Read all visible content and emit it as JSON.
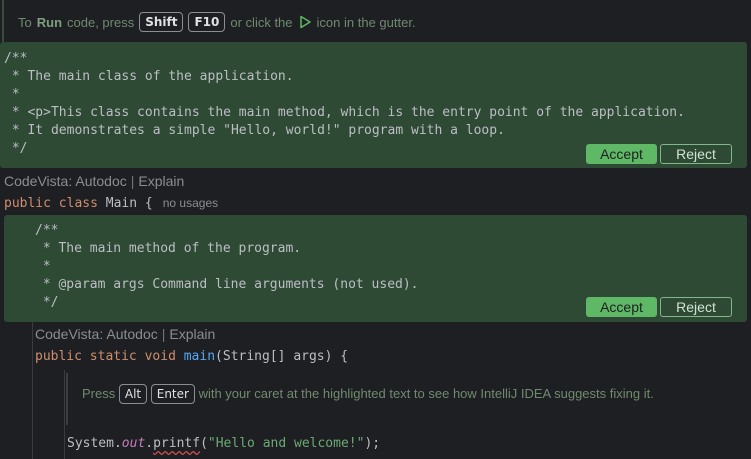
{
  "tip": {
    "prefix": "To",
    "run_word": "Run",
    "middle": "code, press",
    "key1": "Shift",
    "key2": "F10",
    "suffix1": "or click the",
    "suffix2": "icon in the gutter."
  },
  "doc1": {
    "lines": [
      "/**",
      " * The main class of the application.",
      " *",
      " * <p>This class contains the main method, which is the entry point of the application.",
      " * It demonstrates a simple \"Hello, world!\" program with a loop.",
      " */"
    ],
    "accept_label": "Accept",
    "reject_label": "Reject"
  },
  "codevista1": {
    "brand": "CodeVista:",
    "autodoc": "Autodoc",
    "explain": "Explain"
  },
  "class_decl": {
    "public": "public",
    "class": "class",
    "name": "Main",
    "brace": "{",
    "usages": "no usages"
  },
  "doc2": {
    "lines": [
      "/**",
      " * The main method of the program.",
      " *",
      " * @param args Command line arguments (not used).",
      " */"
    ],
    "accept_label": "Accept",
    "reject_label": "Reject"
  },
  "codevista2": {
    "brand": "CodeVista:",
    "autodoc": "Autodoc",
    "explain": "Explain"
  },
  "method_decl": {
    "public": "public",
    "static": "static",
    "void": "void",
    "name": "main",
    "params": "(String[] args) {"
  },
  "hint": {
    "press": "Press",
    "key1": "Alt",
    "key2": "Enter",
    "rest": "with your caret at the highlighted text to see how IntelliJ IDEA suggests fixing it."
  },
  "statement": {
    "obj": "System.",
    "field": "out",
    "dot": ".",
    "method": "printf",
    "args_open": "(",
    "literal": "\"Hello and welcome!\"",
    "args_close": ");"
  }
}
